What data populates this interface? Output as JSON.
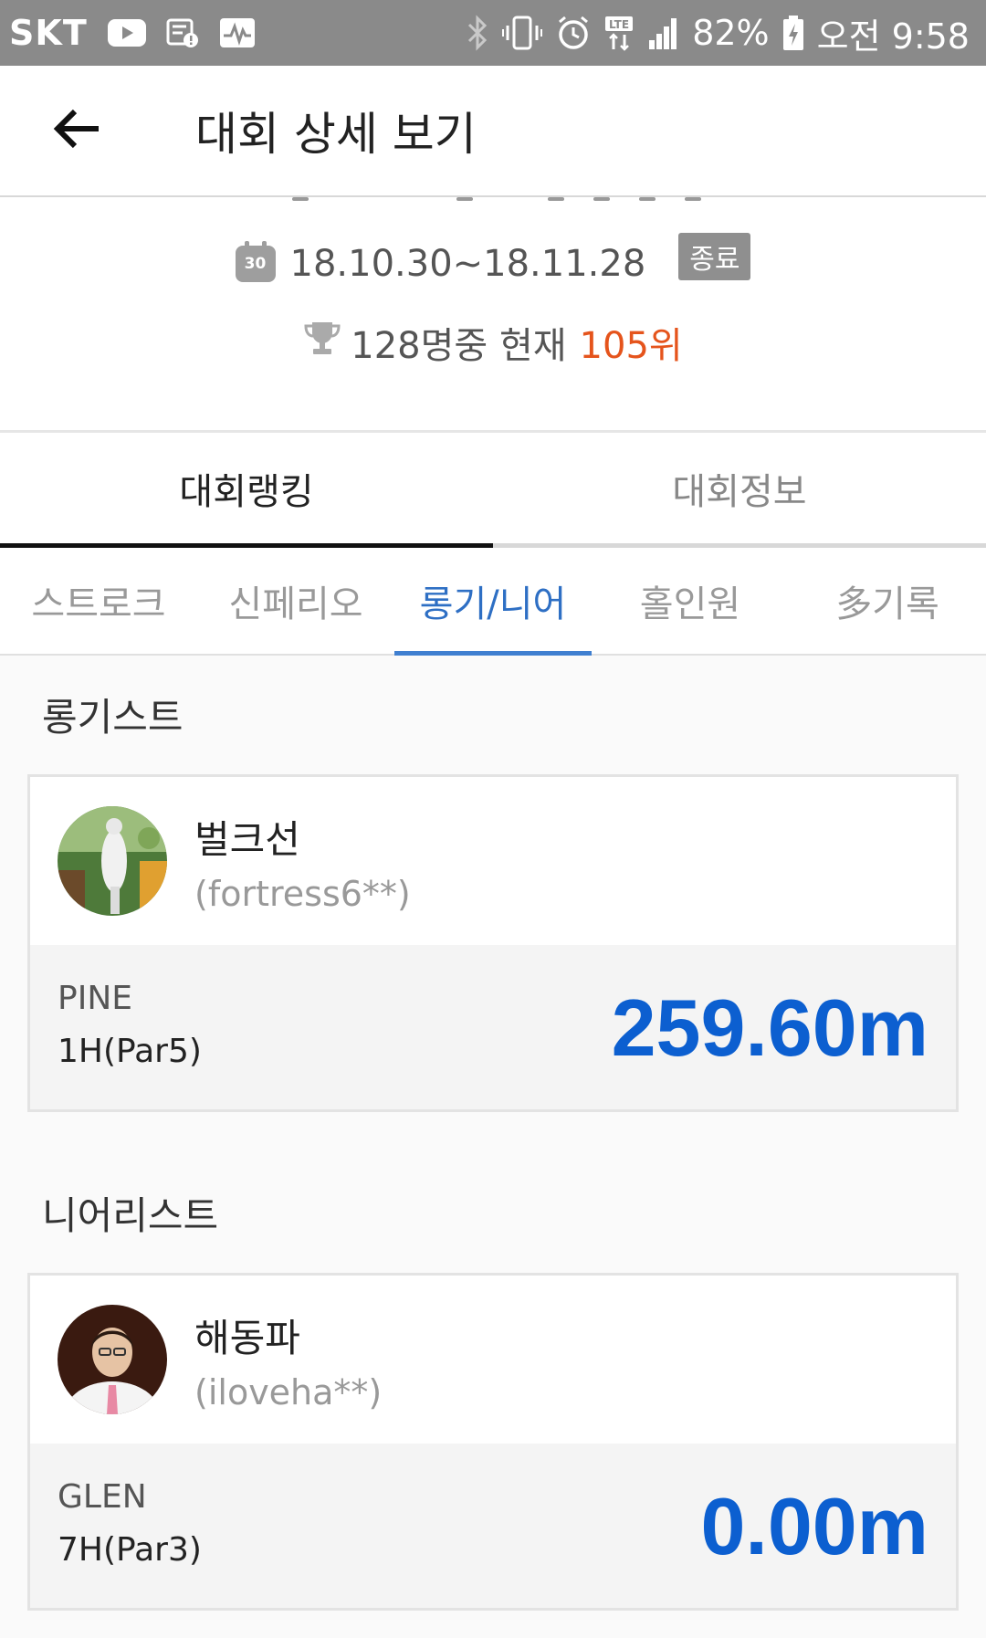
{
  "status_bar": {
    "carrier": "SKT",
    "battery": "82%",
    "time": "오전 9:58",
    "network_label": "LTE",
    "icons": [
      "youtube-icon",
      "notification-icon",
      "activity-icon",
      "bluetooth-icon",
      "vibrate-icon",
      "alarm-icon",
      "lte-icon",
      "signal-icon",
      "battery-icon"
    ]
  },
  "header": {
    "title": "대회 상세 보기",
    "back_icon": "arrow-left-icon"
  },
  "tournament": {
    "date_range": "18.10.30~18.11.28",
    "status_badge": "종료",
    "calendar_icon_label": "30",
    "rank_prefix": "128명중 현재",
    "rank_value": "105위"
  },
  "main_tabs": [
    {
      "label": "대회랭킹",
      "active": true
    },
    {
      "label": "대회정보",
      "active": false
    }
  ],
  "sub_tabs": [
    {
      "label": "스트로크",
      "active": false
    },
    {
      "label": "신페리오",
      "active": false
    },
    {
      "label": "롱기/니어",
      "active": true
    },
    {
      "label": "홀인원",
      "active": false
    },
    {
      "label": "多기록",
      "active": false
    }
  ],
  "longest": {
    "section_title": "롱기스트",
    "name": "벌크선",
    "user_id": "(fortress6**)",
    "course": "PINE",
    "hole": "1H(Par5)",
    "distance": "259.60m"
  },
  "nearest": {
    "section_title": "니어리스트",
    "name": "해동파",
    "user_id": "(iloveha**)",
    "course": "GLEN",
    "hole": "7H(Par3)",
    "distance": "0.00m"
  },
  "colors": {
    "accent_blue": "#0c5fd0",
    "tab_active_blue": "#2e6fc4",
    "rank_orange": "#e5541c",
    "status_bar": "#8a8a8a"
  }
}
